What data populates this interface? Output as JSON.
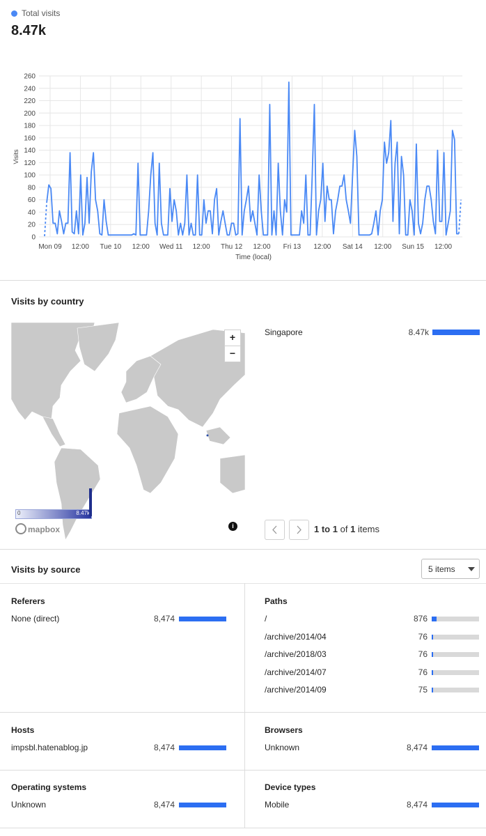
{
  "header": {
    "legend_label": "Total visits",
    "total": "8.47k"
  },
  "chart_data": {
    "type": "line",
    "ylabel": "Visits",
    "xlabel": "Time (local)",
    "ylim": [
      0,
      260
    ],
    "yticks": [
      0,
      20,
      40,
      60,
      80,
      100,
      120,
      140,
      160,
      180,
      200,
      220,
      240,
      260
    ],
    "x_tick_labels": [
      "Mon 09",
      "12:00",
      "Tue 10",
      "12:00",
      "Wed 11",
      "12:00",
      "Thu 12",
      "12:00",
      "Fri 13",
      "12:00",
      "Sat 14",
      "12:00",
      "Sun 15",
      "12:00"
    ],
    "x_hours_range": [
      0,
      168
    ],
    "series": [
      {
        "values": [
          [
            0,
            1
          ],
          [
            0.6,
            55
          ],
          [
            1.2,
            84
          ],
          [
            1.8,
            78
          ],
          [
            2.4,
            22
          ],
          [
            3.0,
            22
          ],
          [
            3.6,
            5
          ],
          [
            4.2,
            42
          ],
          [
            4.8,
            25
          ],
          [
            5.4,
            5
          ],
          [
            6.0,
            22
          ],
          [
            6.6,
            22
          ],
          [
            7.2,
            136
          ],
          [
            7.8,
            8
          ],
          [
            8.4,
            5
          ],
          [
            9.0,
            42
          ],
          [
            9.6,
            5
          ],
          [
            10.2,
            100
          ],
          [
            10.8,
            3
          ],
          [
            11.4,
            22
          ],
          [
            12.0,
            96
          ],
          [
            12.6,
            22
          ],
          [
            13.2,
            105
          ],
          [
            13.8,
            136
          ],
          [
            14.4,
            60
          ],
          [
            15.0,
            42
          ],
          [
            15.6,
            5
          ],
          [
            16.2,
            3
          ],
          [
            16.8,
            60
          ],
          [
            17.4,
            25
          ],
          [
            18.0,
            3
          ],
          [
            18.6,
            3
          ],
          [
            19.2,
            3
          ],
          [
            19.8,
            3
          ],
          [
            20.4,
            3
          ],
          [
            21.0,
            3
          ],
          [
            21.6,
            3
          ],
          [
            22.2,
            3
          ],
          [
            22.8,
            3
          ],
          [
            23.4,
            3
          ],
          [
            24.0,
            3
          ],
          [
            24.6,
            3
          ],
          [
            25.2,
            5
          ],
          [
            25.8,
            3
          ],
          [
            26.4,
            119
          ],
          [
            27.0,
            3
          ],
          [
            27.6,
            3
          ],
          [
            28.2,
            3
          ],
          [
            28.8,
            3
          ],
          [
            29.4,
            42
          ],
          [
            30.0,
            100
          ],
          [
            30.6,
            136
          ],
          [
            31.2,
            22
          ],
          [
            31.8,
            3
          ],
          [
            32.4,
            119
          ],
          [
            33.0,
            22
          ],
          [
            33.6,
            3
          ],
          [
            34.2,
            3
          ],
          [
            34.8,
            3
          ],
          [
            35.4,
            78
          ],
          [
            36.0,
            25
          ],
          [
            36.6,
            60
          ],
          [
            37.2,
            42
          ],
          [
            37.8,
            3
          ],
          [
            38.4,
            22
          ],
          [
            39.0,
            3
          ],
          [
            39.6,
            22
          ],
          [
            40.2,
            100
          ],
          [
            40.8,
            3
          ],
          [
            41.4,
            22
          ],
          [
            42.0,
            3
          ],
          [
            42.6,
            3
          ],
          [
            43.2,
            100
          ],
          [
            43.8,
            3
          ],
          [
            44.4,
            3
          ],
          [
            45.0,
            60
          ],
          [
            45.6,
            22
          ],
          [
            46.2,
            42
          ],
          [
            46.8,
            42
          ],
          [
            47.4,
            5
          ],
          [
            48.0,
            60
          ],
          [
            48.6,
            78
          ],
          [
            49.2,
            3
          ],
          [
            49.8,
            25
          ],
          [
            50.4,
            42
          ],
          [
            51.0,
            22
          ],
          [
            51.6,
            3
          ],
          [
            52.2,
            3
          ],
          [
            52.8,
            22
          ],
          [
            53.4,
            22
          ],
          [
            54.0,
            3
          ],
          [
            54.6,
            5
          ],
          [
            55.2,
            191
          ],
          [
            55.8,
            3
          ],
          [
            56.4,
            42
          ],
          [
            57.0,
            60
          ],
          [
            57.6,
            82
          ],
          [
            58.2,
            25
          ],
          [
            58.8,
            42
          ],
          [
            59.4,
            22
          ],
          [
            60.0,
            3
          ],
          [
            60.6,
            100
          ],
          [
            61.2,
            42
          ],
          [
            61.8,
            3
          ],
          [
            62.4,
            3
          ],
          [
            63.0,
            3
          ],
          [
            63.6,
            214
          ],
          [
            64.2,
            3
          ],
          [
            64.8,
            42
          ],
          [
            65.4,
            3
          ],
          [
            66.0,
            119
          ],
          [
            66.6,
            42
          ],
          [
            67.2,
            3
          ],
          [
            67.8,
            60
          ],
          [
            68.4,
            40
          ],
          [
            69.0,
            250
          ],
          [
            69.6,
            3
          ],
          [
            70.2,
            3
          ],
          [
            70.8,
            3
          ],
          [
            71.4,
            3
          ],
          [
            72.0,
            3
          ],
          [
            72.6,
            42
          ],
          [
            73.2,
            22
          ],
          [
            73.8,
            100
          ],
          [
            74.4,
            3
          ],
          [
            75.0,
            3
          ],
          [
            75.6,
            100
          ],
          [
            76.2,
            214
          ],
          [
            76.8,
            3
          ],
          [
            77.4,
            42
          ],
          [
            78.0,
            60
          ],
          [
            78.6,
            119
          ],
          [
            79.2,
            25
          ],
          [
            79.8,
            82
          ],
          [
            80.4,
            60
          ],
          [
            81.0,
            60
          ],
          [
            81.6,
            5
          ],
          [
            82.2,
            42
          ],
          [
            82.8,
            60
          ],
          [
            83.4,
            82
          ],
          [
            84.0,
            82
          ],
          [
            84.6,
            100
          ],
          [
            85.2,
            60
          ],
          [
            85.8,
            42
          ],
          [
            86.4,
            22
          ],
          [
            87.0,
            100
          ],
          [
            87.6,
            172
          ],
          [
            88.2,
            130
          ],
          [
            88.8,
            3
          ],
          [
            89.4,
            3
          ],
          [
            90.0,
            3
          ],
          [
            90.6,
            3
          ],
          [
            91.2,
            3
          ],
          [
            91.8,
            3
          ],
          [
            92.4,
            5
          ],
          [
            93.0,
            22
          ],
          [
            93.6,
            42
          ],
          [
            94.2,
            3
          ],
          [
            94.8,
            42
          ],
          [
            95.4,
            60
          ],
          [
            96.0,
            153
          ],
          [
            96.6,
            119
          ],
          [
            97.2,
            136
          ],
          [
            97.8,
            188
          ],
          [
            98.4,
            25
          ],
          [
            99.0,
            119
          ],
          [
            99.6,
            153
          ],
          [
            100.2,
            5
          ],
          [
            100.8,
            130
          ],
          [
            101.4,
            100
          ],
          [
            102.0,
            3
          ],
          [
            102.6,
            3
          ],
          [
            103.2,
            60
          ],
          [
            103.8,
            42
          ],
          [
            104.4,
            3
          ],
          [
            105.0,
            150
          ],
          [
            105.6,
            22
          ],
          [
            106.2,
            5
          ],
          [
            106.8,
            22
          ],
          [
            107.4,
            60
          ],
          [
            108.0,
            82
          ],
          [
            108.6,
            82
          ],
          [
            109.2,
            60
          ],
          [
            109.8,
            25
          ],
          [
            110.4,
            5
          ],
          [
            111.0,
            140
          ],
          [
            111.6,
            25
          ],
          [
            112.2,
            25
          ],
          [
            112.8,
            136
          ],
          [
            113.4,
            3
          ],
          [
            114.0,
            22
          ],
          [
            114.6,
            42
          ],
          [
            115.2,
            172
          ],
          [
            115.8,
            157
          ],
          [
            116.4,
            5
          ],
          [
            117.0,
            5
          ],
          [
            117.6,
            60
          ]
        ]
      }
    ]
  },
  "countries": {
    "title": "Visits by country",
    "rows": [
      {
        "name": "Singapore",
        "value": "8.47k",
        "fraction": 1.0
      }
    ],
    "pager": {
      "text_bold_1": "1 to 1",
      "text_of": "of",
      "text_bold_2": "1",
      "text_items": "items"
    },
    "map": {
      "legend_min": "0",
      "legend_max": "8.47k",
      "zoom_in": "+",
      "zoom_out": "−",
      "attribution": "mapbox",
      "info": "i"
    }
  },
  "sources": {
    "title": "Visits by source",
    "select_value": "5 items",
    "referers": {
      "title": "Referers",
      "rows": [
        {
          "label": "None (direct)",
          "value": "8,474",
          "fraction": 1.0
        }
      ]
    },
    "paths": {
      "title": "Paths",
      "rows": [
        {
          "label": "/",
          "value": "876",
          "fraction": 0.1
        },
        {
          "label": "/archive/2014/04",
          "value": "76",
          "fraction": 0.009
        },
        {
          "label": "/archive/2018/03",
          "value": "76",
          "fraction": 0.009
        },
        {
          "label": "/archive/2014/07",
          "value": "76",
          "fraction": 0.009
        },
        {
          "label": "/archive/2014/09",
          "value": "75",
          "fraction": 0.009
        }
      ]
    },
    "hosts": {
      "title": "Hosts",
      "rows": [
        {
          "label": "impsbl.hatenablog.jp",
          "value": "8,474",
          "fraction": 1.0
        }
      ]
    },
    "browsers": {
      "title": "Browsers",
      "rows": [
        {
          "label": "Unknown",
          "value": "8,474",
          "fraction": 1.0
        }
      ]
    },
    "os": {
      "title": "Operating systems",
      "rows": [
        {
          "label": "Unknown",
          "value": "8,474",
          "fraction": 1.0
        }
      ]
    },
    "devices": {
      "title": "Device types",
      "rows": [
        {
          "label": "Mobile",
          "value": "8,474",
          "fraction": 1.0
        }
      ]
    }
  },
  "colors": {
    "series": "#4a89f5",
    "bar": "#2c6ef2",
    "track": "#d9d9d9",
    "land": "#c9c9c9",
    "ocean": "#ffffff"
  }
}
